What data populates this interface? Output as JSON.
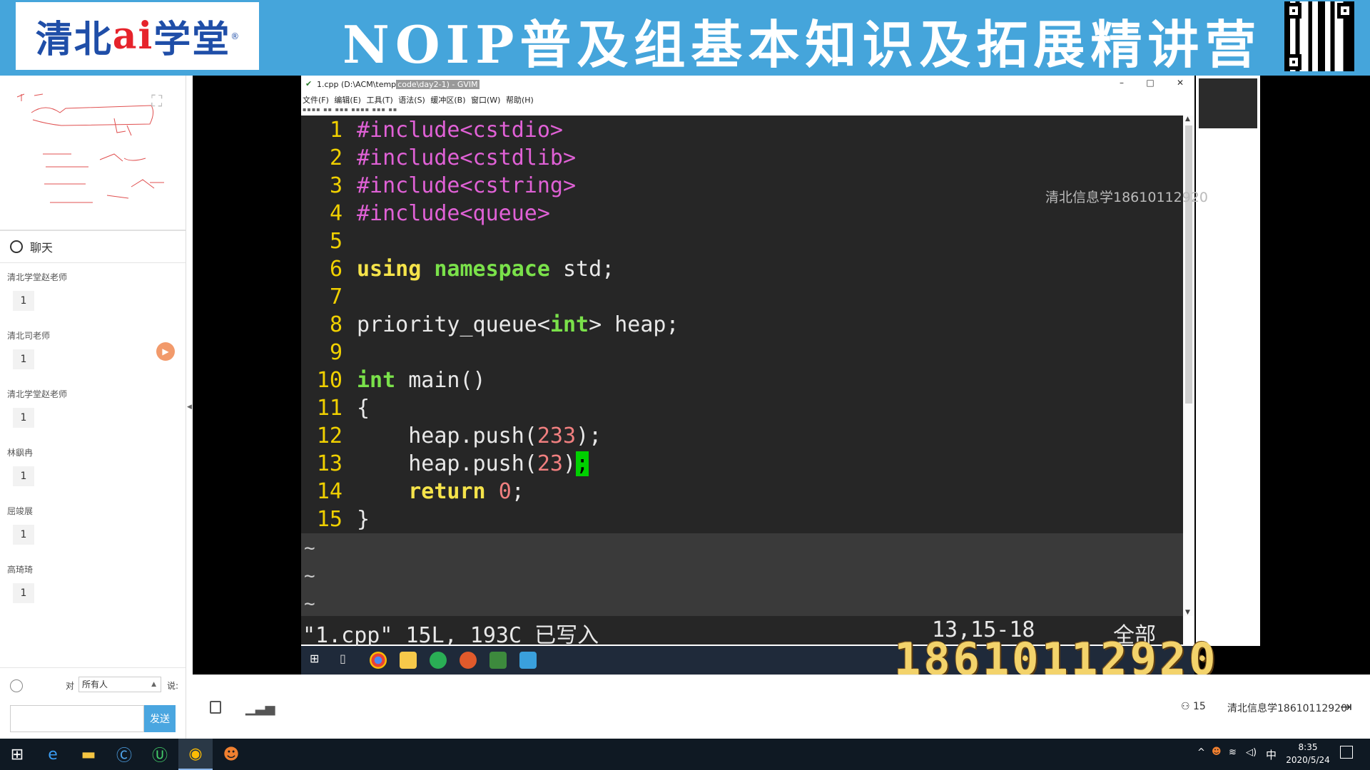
{
  "banner": {
    "logo_text_a": "清北",
    "logo_text_ai": "ai",
    "logo_text_b": "学堂",
    "logo_mark": "®",
    "title": "NOIP普及组基本知识及拓展精讲营"
  },
  "sidebar": {
    "chat_title": "聊天",
    "messages": [
      {
        "name": "清北学堂赵老师",
        "text": "1"
      },
      {
        "name": "清北司老师",
        "text": "1"
      },
      {
        "name": "清北学堂赵老师",
        "text": "1"
      },
      {
        "name": "林飖冉",
        "text": "1"
      },
      {
        "name": "屈竣展",
        "text": "1"
      },
      {
        "name": "高琦琦",
        "text": "1"
      }
    ],
    "to_label": "对",
    "recipient": "所有人",
    "say_label": "说:",
    "send_label": "发送"
  },
  "gvim": {
    "title_a": "1.cpp (D:\\ACM\\temp",
    "title_b": "code\\day2-1) - GVIM",
    "menu": [
      "文件(F)",
      "编辑(E)",
      "工具(T)",
      "语法(S)",
      "缓冲区(B)",
      "窗口(W)",
      "帮助(H)"
    ],
    "lines": [
      {
        "n": "1",
        "code": "#include<cstdio>"
      },
      {
        "n": "2",
        "code": "#include<cstdlib>"
      },
      {
        "n": "3",
        "code": "#include<cstring>"
      },
      {
        "n": "4",
        "code": "#include<queue>"
      },
      {
        "n": "5",
        "code": ""
      },
      {
        "n": "6",
        "kw": "using",
        "kw2": "namespace",
        "rest": " std;"
      },
      {
        "n": "7",
        "code": ""
      },
      {
        "n": "8",
        "a": "priority_queue<",
        "ty": "int",
        "b": "> heap;"
      },
      {
        "n": "9",
        "code": ""
      },
      {
        "n": "10",
        "ty": "int",
        "b": " main()"
      },
      {
        "n": "11",
        "code": "{"
      },
      {
        "n": "12",
        "a": "    heap.push(",
        "num": "233",
        "b": ");"
      },
      {
        "n": "13",
        "a": "    heap.push(",
        "num": "23",
        "b": ")",
        "cursor": ";"
      },
      {
        "n": "14",
        "kwi": "    ",
        "kw": "return",
        "sp": " ",
        "num": "0",
        "b": ";"
      },
      {
        "n": "15",
        "code": "}"
      }
    ],
    "status_file": "\"1.cpp\" 15L, 193C 已写入",
    "status_pos": "13,15-18",
    "status_all": "全部",
    "watermark": "清北信息学18610112920",
    "phone": "18610112920"
  },
  "controls": {
    "viewer_count": "15",
    "user_name": "清北信息学18610112920"
  },
  "taskbar": {
    "ime": "中",
    "time": "8:35",
    "date": "2020/5/24"
  },
  "colors": {
    "banner": "#45a5db",
    "send_button": "#4aa6e0",
    "vim_bg": "#262626",
    "line_number": "#f0d000",
    "keyword": "#f5e34a",
    "type": "#7ae14a",
    "preproc": "#e061d6",
    "number": "#f07f7f",
    "cursor": "#00d000"
  }
}
